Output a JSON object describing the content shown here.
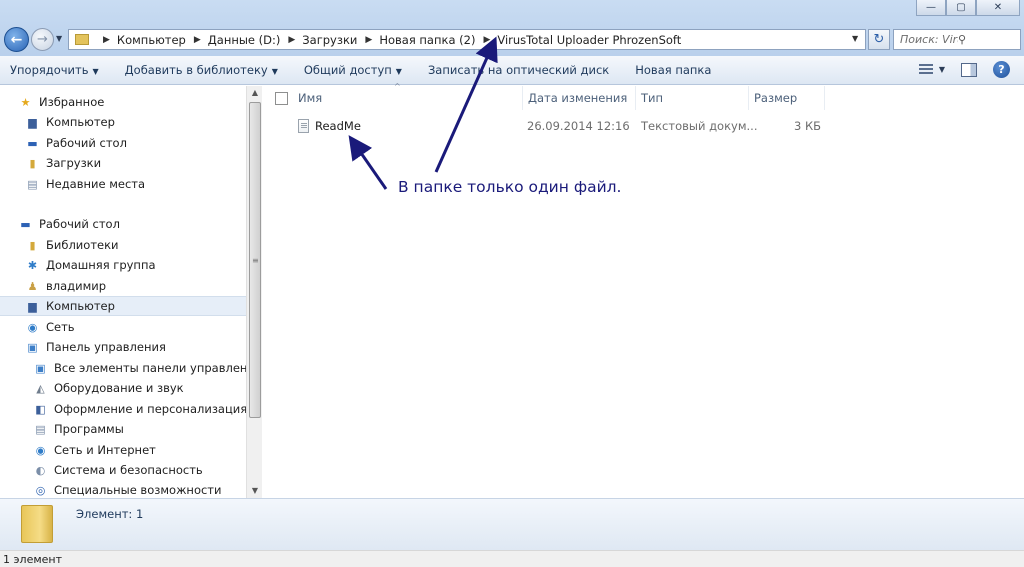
{
  "window": {
    "minimize": "—",
    "maximize": "▢",
    "close": "✕"
  },
  "address": {
    "crumbs": [
      "Компьютер",
      "Данные (D:)",
      "Загрузки",
      "Новая папка (2)",
      "VirusTotal Uploader PhrozenSoft"
    ]
  },
  "search": {
    "placeholder": "Поиск: VirusTotal ..."
  },
  "toolbar": {
    "organize": "Упорядочить",
    "add_library": "Добавить в библиотеку",
    "share": "Общий доступ",
    "burn": "Записать на оптический диск",
    "new_folder": "Новая папка"
  },
  "nav": {
    "favorites": "Избранное",
    "fav_computer": "Компьютер",
    "fav_desktop": "Рабочий стол",
    "fav_downloads": "Загрузки",
    "fav_recent": "Недавние места",
    "desktop": "Рабочий стол",
    "libraries": "Библиотеки",
    "homegroup": "Домашняя группа",
    "user": "владимир",
    "computer": "Компьютер",
    "network": "Сеть",
    "control_panel": "Панель управления",
    "cp_all": "Все элементы панели управления",
    "cp_hardware": "Оборудование и звук",
    "cp_appearance": "Оформление и персонализация",
    "cp_programs": "Программы",
    "cp_network": "Сеть и Интернет",
    "cp_security": "Система и безопасность",
    "cp_access": "Специальные возможности"
  },
  "columns": {
    "name": "Имя",
    "date": "Дата изменения",
    "type": "Тип",
    "size": "Размер"
  },
  "files": [
    {
      "name": "ReadMe",
      "date": "26.09.2014 12:16",
      "type": "Текстовый докум...",
      "size": "3 КБ"
    }
  ],
  "annotation": "В папке только один файл.",
  "details": {
    "count": "Элемент: 1"
  },
  "status": {
    "text": "1 элемент"
  }
}
